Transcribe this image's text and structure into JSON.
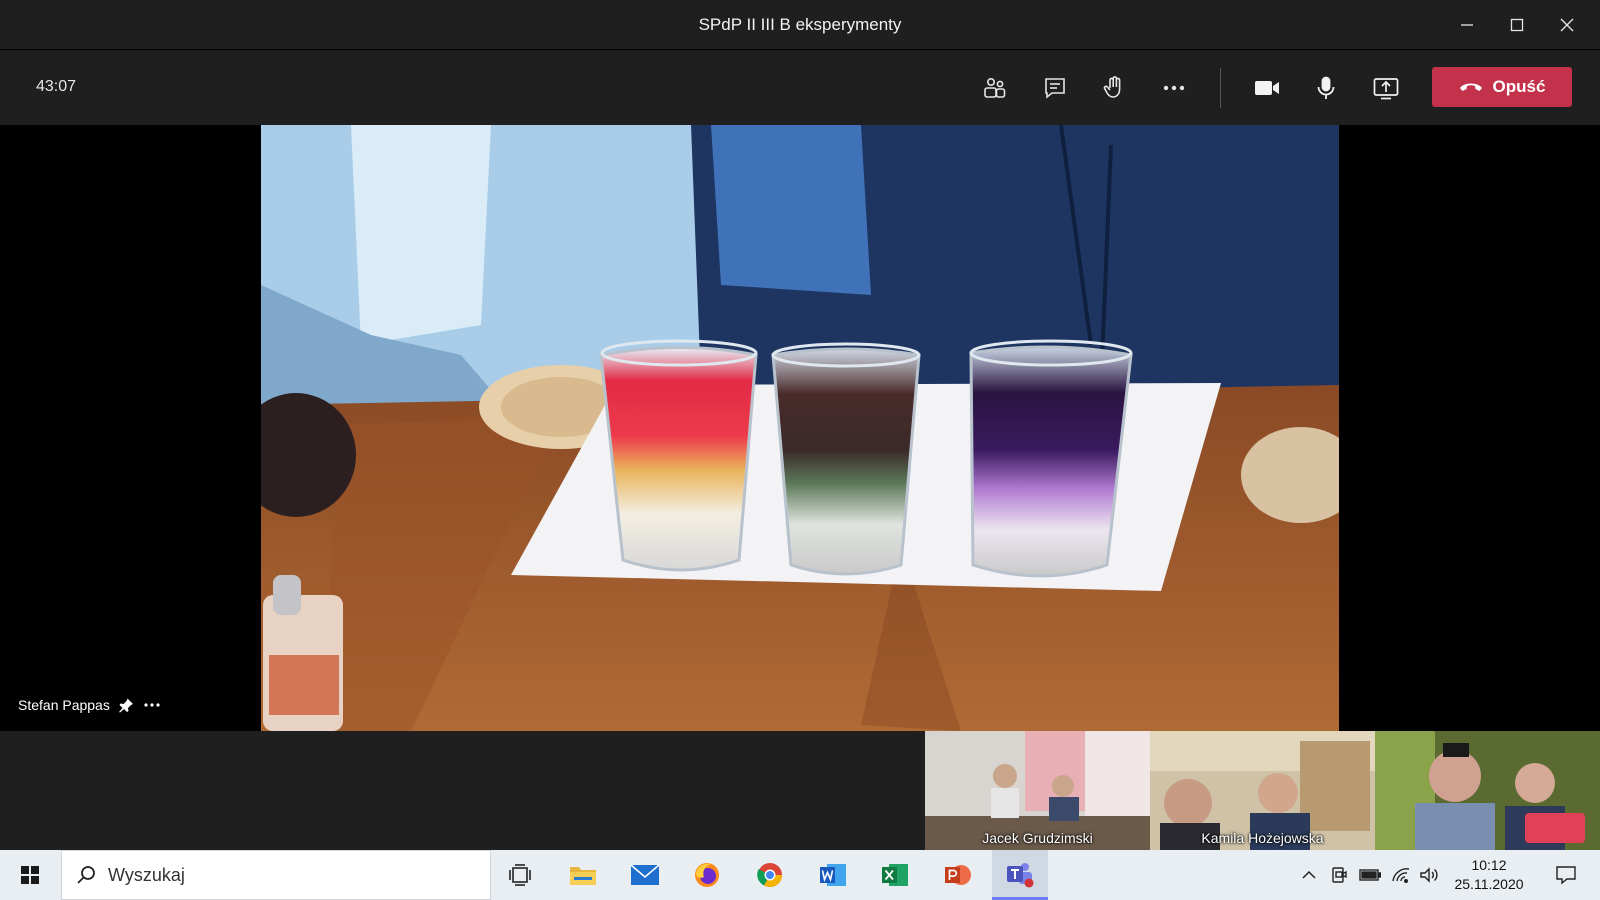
{
  "window": {
    "title": "SPdP II III B eksperymenty"
  },
  "controls": {
    "timer": "43:07",
    "leave_label": "Opuść"
  },
  "stage": {
    "active_speaker": "Stefan Pappas"
  },
  "participants": [
    {
      "name": "Jacek Grudzimski"
    },
    {
      "name": "Kamila Hożejowska"
    },
    {
      "name": ""
    }
  ],
  "taskbar": {
    "search_placeholder": "Wyszukaj",
    "apps": [
      "task-view",
      "file-explorer",
      "mail",
      "firefox",
      "chrome",
      "word",
      "excel",
      "powerpoint",
      "teams"
    ],
    "time": "10:12",
    "date": "25.11.2020"
  },
  "colors": {
    "leave_red": "#c4314b",
    "bar_dark": "#1f1f1f",
    "taskbar_bg": "#e9eef3"
  }
}
